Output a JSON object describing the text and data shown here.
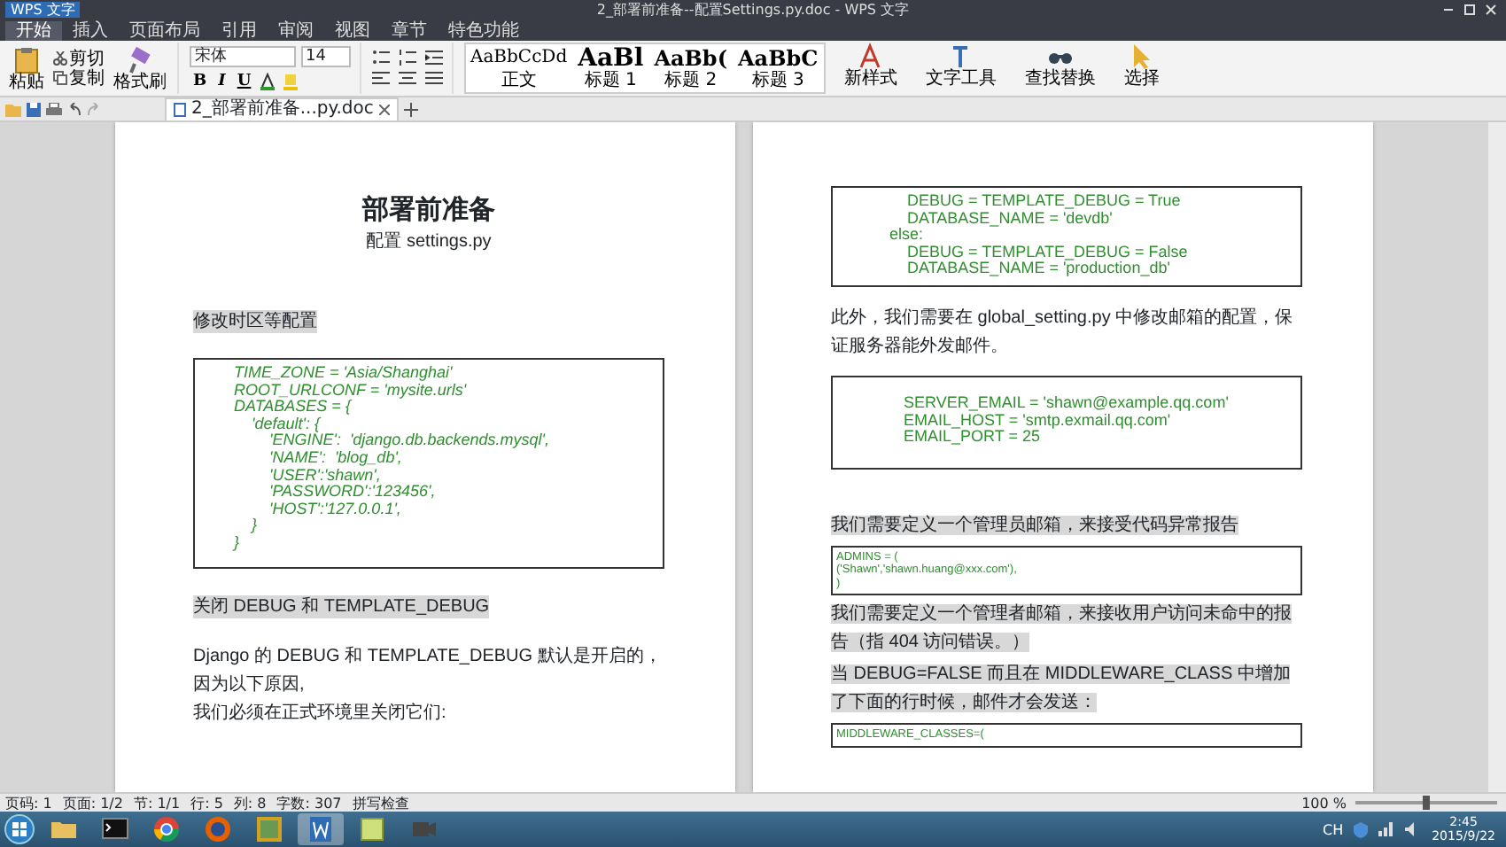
{
  "window": {
    "app_button": "WPS 文字",
    "title": "2_部署前准备--配置Settings.py.doc - WPS 文字"
  },
  "menu_tabs": [
    {
      "label": "开始",
      "selected": true
    },
    {
      "label": "插入",
      "selected": false
    },
    {
      "label": "页面布局",
      "selected": false
    },
    {
      "label": "引用",
      "selected": false
    },
    {
      "label": "审阅",
      "selected": false
    },
    {
      "label": "视图",
      "selected": false
    },
    {
      "label": "章节",
      "selected": false
    },
    {
      "label": "特色功能",
      "selected": false
    }
  ],
  "ribbon": {
    "paste": "粘贴",
    "cut": "剪切",
    "copy": "复制",
    "format_painter": "格式刷",
    "font_name": "宋体",
    "font_size": "14",
    "format_buttons": [
      "B",
      "I",
      "U"
    ],
    "styles": [
      {
        "preview": "AaBbCcDd",
        "label": "正文"
      },
      {
        "preview": "AaBl",
        "label": "标题 1"
      },
      {
        "preview": "AaBb(",
        "label": "标题 2"
      },
      {
        "preview": "AaBbC",
        "label": "标题 3"
      }
    ],
    "tools": [
      {
        "kind": "style",
        "label": "新样式"
      },
      {
        "kind": "text",
        "label": "文字工具"
      },
      {
        "kind": "find",
        "label": "查找替换"
      },
      {
        "kind": "select",
        "label": "选择"
      }
    ]
  },
  "doc_tabs": [
    {
      "label": "2_部署前准备...py.doc",
      "selected": true
    }
  ],
  "pages": [
    {
      "blocks": [
        {
          "kind": "title",
          "text": "部署前准备"
        },
        {
          "kind": "subtitle",
          "text": "配置 settings.py"
        },
        {
          "kind": "section",
          "text": "修改时区等配置",
          "highlighted": true
        },
        {
          "kind": "code",
          "italic": true,
          "lines": [
            "TIME_ZONE = 'Asia/Shanghai'",
            "ROOT_URLCONF = 'mysite.urls'",
            "DATABASES = {",
            "    'default': {",
            "        'ENGINE':  'django.db.backends.mysql',",
            "        'NAME':  'blog_db',",
            "        'USER':'shawn',",
            "        'PASSWORD':'123456',",
            "        'HOST':'127.0.0.1',",
            "    }",
            "}"
          ]
        },
        {
          "kind": "section",
          "text": "关闭 DEBUG 和 TEMPLATE_DEBUG",
          "highlighted": true
        },
        {
          "kind": "paragraph",
          "text": "Django 的 DEBUG 和 TEMPLATE_DEBUG 默认是开启的，因为以下原因,",
          "highlighted": false
        },
        {
          "kind": "paragraph",
          "text": "我们必须在正式环境里关闭它们:",
          "highlighted": false
        }
      ]
    },
    {
      "blocks": [
        {
          "kind": "code",
          "italic": false,
          "lines": [
            "        DEBUG = TEMPLATE_DEBUG = True",
            "        DATABASE_NAME = 'devdb'",
            "    else:",
            "        DEBUG = TEMPLATE_DEBUG = False",
            "        DATABASE_NAME = 'production_db'"
          ]
        },
        {
          "kind": "paragraph",
          "text": "此外，我们需要在 global_setting.py 中修改邮箱的配置，保证服务器能外发邮件。",
          "highlighted": false
        },
        {
          "kind": "code",
          "italic": false,
          "lines": [
            "SERVER_EMAIL = 'shawn@example.qq.com'",
            "EMAIL_HOST = 'smtp.exmail.qq.com'",
            "EMAIL_PORT = 25"
          ]
        },
        {
          "kind": "paragraph",
          "text": "我们需要定义一个管理员邮箱，来接受代码异常报告",
          "highlighted": true
        },
        {
          "kind": "smallcode",
          "italic": false,
          "lines": [
            "ADMINS = (",
            "('Shawn','shawn.huang@xxx.com'),",
            ")"
          ]
        },
        {
          "kind": "paragraph",
          "text": "我们需要定义一个管理者邮箱，来接收用户访问未命中的报告（指 404 访问错误。）",
          "highlighted": true
        },
        {
          "kind": "paragraph",
          "text": "当 DEBUG=FALSE 而且在 MIDDLEWARE_CLASS 中增加了下面的行时候，邮件才会发送：",
          "highlighted": true
        },
        {
          "kind": "smallcode",
          "italic": false,
          "lines": [
            "MIDDLEWARE_CLASSES=("
          ]
        }
      ]
    }
  ],
  "status_bar": {
    "items": [
      "页码: 1",
      "页面: 1/2",
      "节: 1/1",
      "行: 5",
      "列: 8",
      "字数: 307",
      "拼写检查"
    ],
    "zoom": {
      "text": "100 %",
      "level": 0.5
    }
  },
  "taskbar": {
    "apps": [
      {
        "kind": "folder",
        "selected": false
      },
      {
        "kind": "terminal",
        "selected": false
      },
      {
        "kind": "chrome",
        "selected": false
      },
      {
        "kind": "firefox",
        "selected": false
      },
      {
        "kind": "app",
        "selected": false
      },
      {
        "kind": "wps",
        "selected": true
      },
      {
        "kind": "notes",
        "selected": false
      },
      {
        "kind": "media",
        "selected": false
      }
    ],
    "language": "CH",
    "time": "2:45",
    "date": "2015/9/22"
  }
}
